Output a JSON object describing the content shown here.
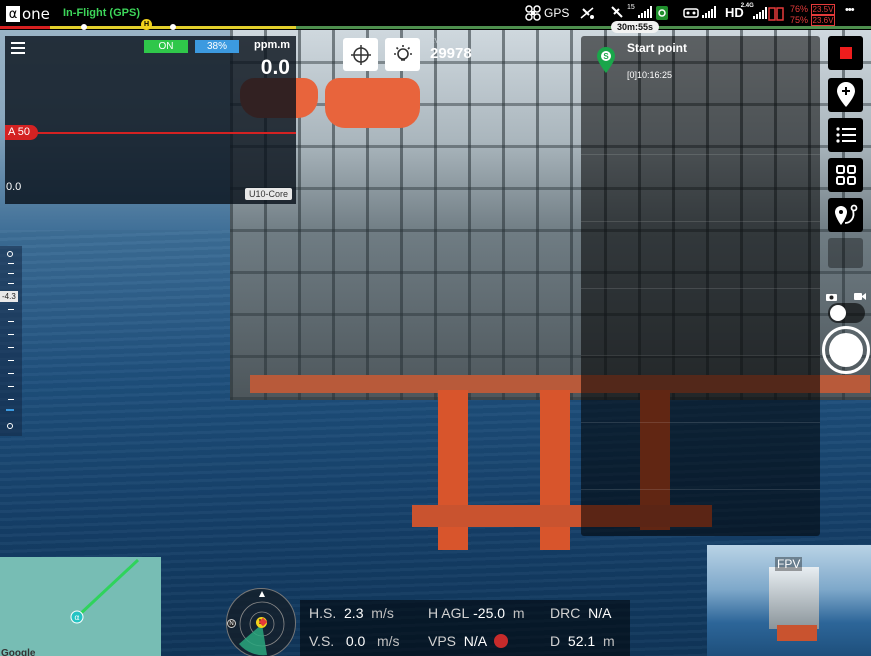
{
  "top_bar": {
    "logo_glyph": "α",
    "logo_text": "one",
    "flight_status": "In-Flight (GPS)",
    "home_marker": "H",
    "gps_label": "GPS",
    "satellite_count": "15",
    "video_label": "HD",
    "video_bitrate": "2.4G",
    "timer": "30m:55s",
    "battery_1_percent": "76%",
    "battery_1_voltage": "23.5V",
    "battery_2_percent": "75%",
    "battery_2_voltage": "23.6V",
    "more_glyph": "•••",
    "progress_fraction": 0.34
  },
  "sensor_panel": {
    "power_state": "ON",
    "level_percent": "38%",
    "unit": "ppm.m",
    "reading": "0.0",
    "alarm_threshold": "A 50",
    "axis_min": "0.0",
    "device_name": "U10-Core"
  },
  "camera": {
    "meter_label": "EV",
    "meter_value": "29978"
  },
  "waypoint_panel": {
    "pin_letter": "S",
    "title": "Start point",
    "timestamp": "[0]10:16:25"
  },
  "gimbal": {
    "pitch_value": "-4.3"
  },
  "map": {
    "drone_glyph": "α",
    "attribution": "Google"
  },
  "radar": {
    "north": "N",
    "home": "H"
  },
  "telemetry": {
    "hs_label": "H.S.",
    "hs_value": "2.3",
    "hs_unit": "m/s",
    "vs_label": "V.S.",
    "vs_value": "0.0",
    "vs_unit": "m/s",
    "hagl_label": "H AGL",
    "hagl_value": "-25.0",
    "hagl_unit": "m",
    "vps_label": "VPS",
    "vps_value": "N/A",
    "drc_label": "DRC",
    "drc_value": "N/A",
    "d_label": "D",
    "d_value": "52.1",
    "d_unit": "m"
  },
  "fpv": {
    "label": "FPV"
  },
  "colors": {
    "in_flight_green": "#3dd65a",
    "alarm_red": "#d42222",
    "stop_red": "#ef1d1d",
    "percent_blue": "#3c9ae0",
    "on_green": "#2fc74a"
  }
}
